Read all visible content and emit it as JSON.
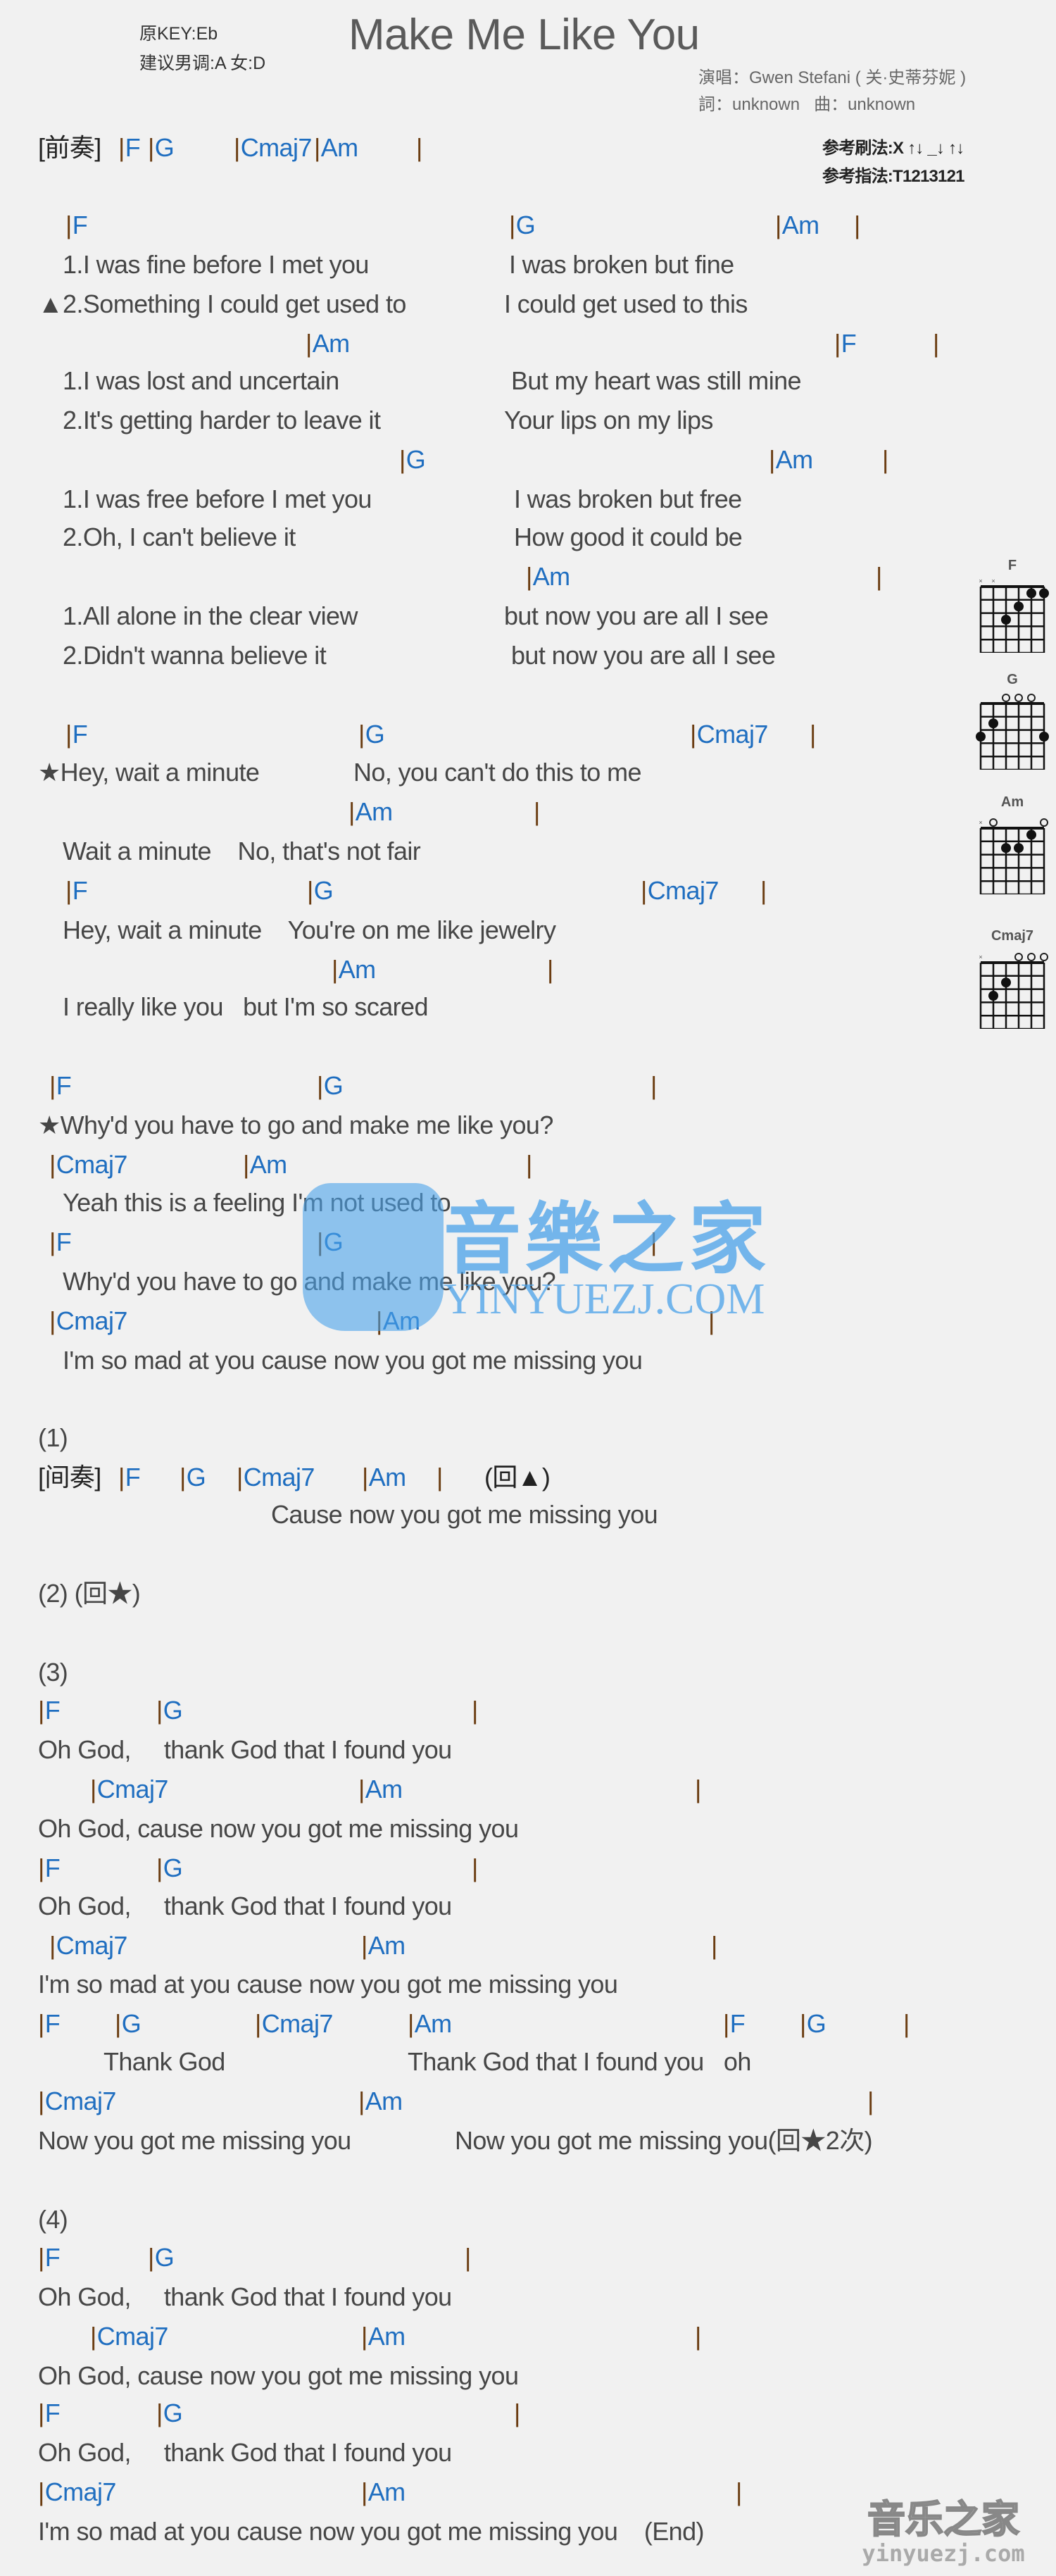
{
  "header": {
    "original_key": "原KEY:Eb",
    "suggested_key": "建议男调:A 女:D",
    "title": "Make Me Like You",
    "singer": "演唱：Gwen Stefani ( 关·史蒂芬妮 )",
    "credits": "詞：unknown   曲：unknown",
    "strum_pattern": "参考刷法:X ↑↓ _↓ ↑↓",
    "finger_pattern": "参考指法:T1213121"
  },
  "colors": {
    "chord": "#1f6ec0",
    "bar": "#6b3d12",
    "lyric": "#464646",
    "watermark": "#4aa2ea"
  },
  "lines": [
    {
      "type": "intro",
      "label": "[前奏]",
      "segs": [
        "F",
        "G",
        "Cmaj7",
        "Am",
        ""
      ]
    },
    {
      "type": "chord",
      "segs": [
        "F",
        "G",
        "Am",
        ""
      ]
    },
    {
      "type": "lyric",
      "segs": [
        "1.I was fine before I met you",
        "I was broken but fine"
      ]
    },
    {
      "type": "lyric",
      "segs": [
        "▲2.Something I could get used to",
        "I could get used to this"
      ]
    },
    {
      "type": "chord",
      "segs": [
        "Am",
        "F",
        ""
      ]
    },
    {
      "type": "lyric",
      "segs": [
        "1.I was lost and uncertain",
        "But my heart was still mine"
      ]
    },
    {
      "type": "lyric",
      "segs": [
        "2.It's getting harder to leave it",
        "Your lips on my lips"
      ]
    },
    {
      "type": "chord",
      "segs": [
        "G",
        "Am",
        ""
      ]
    },
    {
      "type": "lyric",
      "segs": [
        "1.I was free before I met you",
        "I was broken but free"
      ]
    },
    {
      "type": "lyric",
      "segs": [
        "2.Oh, I can't believe it",
        "How good it could be"
      ]
    },
    {
      "type": "chord",
      "segs": [
        "Am",
        ""
      ]
    },
    {
      "type": "lyric",
      "segs": [
        "1.All alone in the clear view",
        "but now you are all I see"
      ]
    },
    {
      "type": "lyric",
      "segs": [
        "2.Didn't wanna believe it",
        "but now you are all I see"
      ]
    },
    {
      "type": "chord",
      "segs": [
        "F",
        "G",
        "Cmaj7",
        ""
      ]
    },
    {
      "type": "lyric",
      "segs": [
        "★Hey, wait a minute",
        "No, you can't do this to me"
      ]
    },
    {
      "type": "chord",
      "segs": [
        "Am",
        ""
      ]
    },
    {
      "type": "lyric",
      "segs": [
        "Wait a minute    No, that's not fair"
      ]
    },
    {
      "type": "chord",
      "segs": [
        "F",
        "G",
        "Cmaj7",
        ""
      ]
    },
    {
      "type": "lyric",
      "segs": [
        "Hey, wait a minute    You're on me like jewelry"
      ]
    },
    {
      "type": "chord",
      "segs": [
        "Am",
        ""
      ]
    },
    {
      "type": "lyric",
      "segs": [
        "I really like you   but I'm so scared"
      ]
    },
    {
      "type": "chord",
      "segs": [
        "F",
        "G",
        ""
      ]
    },
    {
      "type": "lyric",
      "segs": [
        "★Why'd you have to go and make me like you?"
      ]
    },
    {
      "type": "chord",
      "segs": [
        "Cmaj7",
        "Am",
        ""
      ]
    },
    {
      "type": "lyric",
      "segs": [
        "Yeah this is a feeling I'm not used to"
      ]
    },
    {
      "type": "chord",
      "segs": [
        "F",
        "G",
        ""
      ]
    },
    {
      "type": "lyric",
      "segs": [
        "Why'd you have to go and make me like you?"
      ]
    },
    {
      "type": "chord",
      "segs": [
        "Cmaj7",
        "Am",
        ""
      ]
    },
    {
      "type": "lyric",
      "segs": [
        "I'm so mad at you cause now you got me missing you"
      ]
    },
    {
      "type": "lyric",
      "segs": [
        "(1)"
      ]
    },
    {
      "type": "intro",
      "label": "[间奏]",
      "segs": [
        "F",
        "G",
        "Cmaj7",
        "Am",
        ""
      ],
      "tail": "(回▲)"
    },
    {
      "type": "lyric",
      "segs": [
        "Cause now you got me missing you"
      ]
    },
    {
      "type": "lyric",
      "segs": [
        "(2) (回★)"
      ]
    },
    {
      "type": "lyric",
      "segs": [
        "(3)"
      ]
    },
    {
      "type": "chord",
      "segs": [
        "F",
        "G",
        ""
      ]
    },
    {
      "type": "lyric",
      "segs": [
        "Oh God,     thank God that I found you"
      ]
    },
    {
      "type": "chord",
      "segs": [
        "Cmaj7",
        "Am",
        ""
      ]
    },
    {
      "type": "lyric",
      "segs": [
        "Oh God, cause now you got me missing you"
      ]
    },
    {
      "type": "chord",
      "segs": [
        "F",
        "G",
        ""
      ]
    },
    {
      "type": "lyric",
      "segs": [
        "Oh God,     thank God that I found you"
      ]
    },
    {
      "type": "chord",
      "segs": [
        "Cmaj7",
        "Am",
        ""
      ]
    },
    {
      "type": "lyric",
      "segs": [
        "I'm so mad at you cause now you got me missing you"
      ]
    },
    {
      "type": "chord",
      "segs": [
        "F",
        "G",
        "Cmaj7",
        "Am",
        "F",
        "G",
        ""
      ]
    },
    {
      "type": "lyric",
      "segs": [
        "Thank God",
        "Thank God that I found you   oh"
      ]
    },
    {
      "type": "chord",
      "segs": [
        "Cmaj7",
        "Am",
        ""
      ]
    },
    {
      "type": "lyric",
      "segs": [
        "Now you got me missing you",
        "Now you got me missing you(回★2次)"
      ]
    },
    {
      "type": "lyric",
      "segs": [
        "(4)"
      ]
    },
    {
      "type": "chord",
      "segs": [
        "F",
        "G",
        ""
      ]
    },
    {
      "type": "lyric",
      "segs": [
        "Oh God,     thank God that I found you"
      ]
    },
    {
      "type": "chord",
      "segs": [
        "Cmaj7",
        "Am",
        ""
      ]
    },
    {
      "type": "lyric",
      "segs": [
        "Oh God, cause now you got me missing you"
      ]
    },
    {
      "type": "chord",
      "segs": [
        "F",
        "G",
        ""
      ]
    },
    {
      "type": "lyric",
      "segs": [
        "Oh God,     thank God that I found you"
      ]
    },
    {
      "type": "chord",
      "segs": [
        "Cmaj7",
        "Am",
        ""
      ]
    },
    {
      "type": "lyric",
      "segs": [
        "I'm so mad at you cause now you got me missing you    (End)"
      ]
    }
  ],
  "chord_diagrams": [
    {
      "name": "F",
      "frets": "xx3211"
    },
    {
      "name": "G",
      "frets": "320003"
    },
    {
      "name": "Am",
      "frets": "x02210"
    },
    {
      "name": "Cmaj7",
      "frets": "x32000"
    }
  ],
  "watermark": {
    "logo_text": "音樂之家",
    "url": "YINYUEZJ.COM"
  },
  "footer_logo": {
    "text": "音乐之家",
    "url": "yinyuezj.com"
  }
}
